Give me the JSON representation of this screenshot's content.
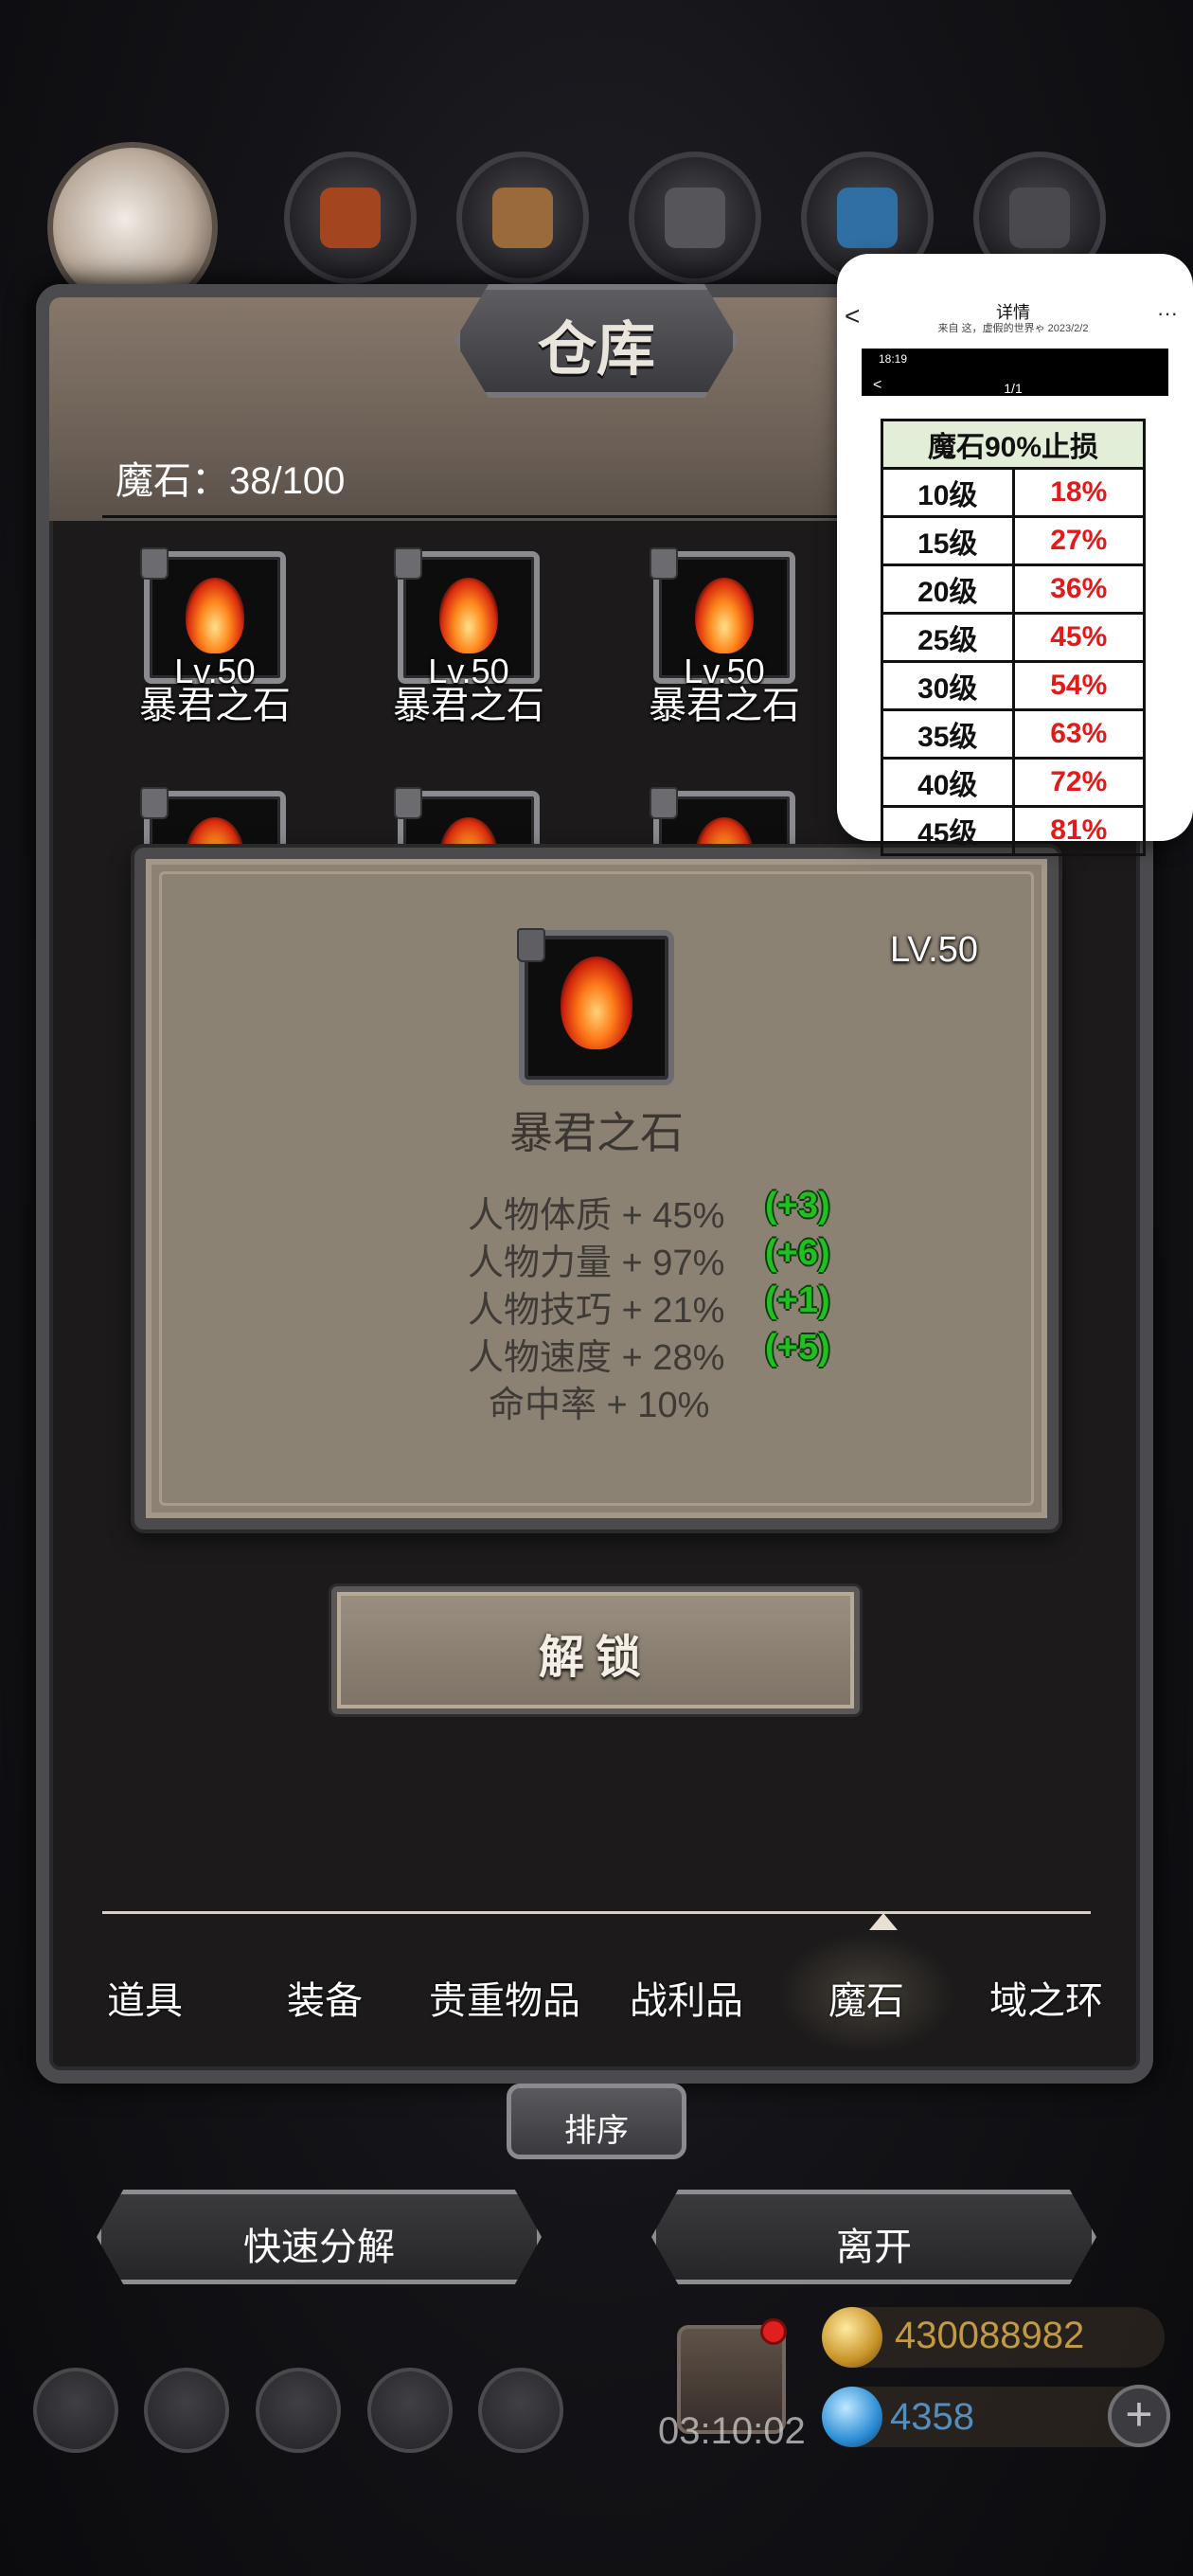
{
  "window": {
    "title": "仓库"
  },
  "inventory": {
    "magic_stone_count": "魔石：38/100"
  },
  "grid": {
    "row1": [
      {
        "level": "Lv.50",
        "name": "暴君之石"
      },
      {
        "level": "Lv.50",
        "name": "暴君之石"
      },
      {
        "level": "Lv.50",
        "name": "暴君之石"
      }
    ]
  },
  "popup": {
    "level": "LV.50",
    "name": "暴君之石",
    "stats": [
      {
        "label": "人物体质 + 45%",
        "bonus": "(+3)"
      },
      {
        "label": "人物力量 + 97%",
        "bonus": "(+6)"
      },
      {
        "label": "人物技巧 + 21%",
        "bonus": "(+1)"
      },
      {
        "label": "人物速度 + 28%",
        "bonus": "(+5)"
      },
      {
        "label": "命中率 + 10%",
        "bonus": ""
      }
    ],
    "unlock_label": "解锁"
  },
  "tabs": [
    {
      "label": "道具",
      "active": false
    },
    {
      "label": "装备",
      "active": false
    },
    {
      "label": "贵重物品",
      "active": false
    },
    {
      "label": "战利品",
      "active": false
    },
    {
      "label": "魔石",
      "active": true
    },
    {
      "label": "域之环",
      "active": false
    }
  ],
  "buttons": {
    "sort": "排序",
    "quick_decompose": "快速分解",
    "leave": "离开"
  },
  "bottom_bar": {
    "timer": "03:10:02",
    "gold": "430088982",
    "gems": "4358",
    "plus": "+"
  },
  "overlay_card": {
    "back": "<",
    "title": "详情",
    "subtitle": "来自 这，虚假的世界ゃ 2023/2/2",
    "more": "···",
    "screenshot_time": "18:19",
    "screenshot_status": "",
    "screenshot_back": "<",
    "page_indicator": "1/1",
    "table_header": "魔石90%止损",
    "rows": [
      {
        "level": "10级",
        "pct": "18%"
      },
      {
        "level": "15级",
        "pct": "27%"
      },
      {
        "level": "20级",
        "pct": "36%"
      },
      {
        "level": "25级",
        "pct": "45%"
      },
      {
        "level": "30级",
        "pct": "54%"
      },
      {
        "level": "35级",
        "pct": "63%"
      },
      {
        "level": "40级",
        "pct": "72%"
      },
      {
        "level": "45级",
        "pct": "81%"
      }
    ]
  },
  "colors": {
    "bonus_green": "#20c020",
    "pct_red": "#e21a1a",
    "popup_bg": "#8c8274"
  }
}
